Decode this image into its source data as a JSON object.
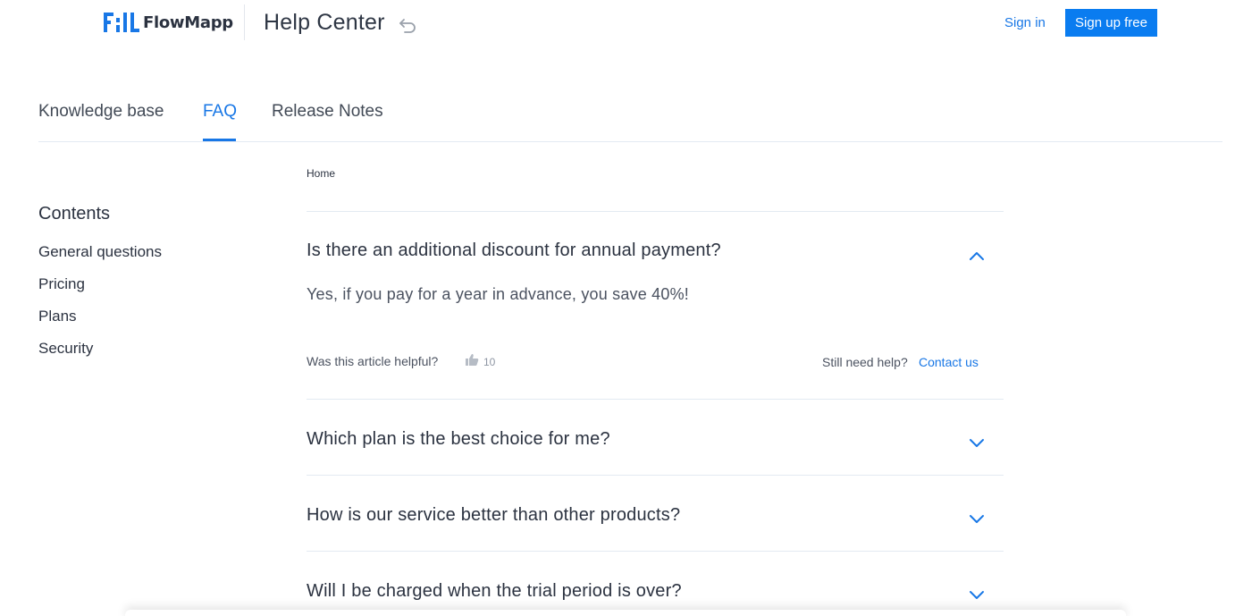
{
  "header": {
    "logo_text": "FlowMapp",
    "help_center": "Help Center",
    "sign_in": "Sign in",
    "sign_up": "Sign up free"
  },
  "tabs": [
    {
      "label": "Knowledge base",
      "active": false
    },
    {
      "label": "FAQ",
      "active": true
    },
    {
      "label": "Release Notes",
      "active": false
    }
  ],
  "sidebar": {
    "title": "Contents",
    "items": [
      "General questions",
      "Pricing",
      "Plans",
      "Security"
    ]
  },
  "breadcrumb": "Home",
  "faq": [
    {
      "question": "Is there an additional discount for annual payment?",
      "expanded": true,
      "answer": "Yes, if you pay for a year in advance, you save 40%!"
    },
    {
      "question": "Which plan is the best choice for me?",
      "expanded": false
    },
    {
      "question": "How is our service better than other products?",
      "expanded": false
    },
    {
      "question": "Will I be charged when the trial period is over?",
      "expanded": false
    }
  ],
  "feedback": {
    "helpful_label": "Was this article helpful?",
    "likes": "10",
    "still_need_help": "Still need help?",
    "contact_us": "Contact us"
  },
  "colors": {
    "accent": "#1877e6",
    "button": "#0a7cf0",
    "text": "#2b3240",
    "divider": "#e3eaf2"
  },
  "icons": [
    "flowmapp-logo-icon",
    "back-arrow-icon",
    "chevron-up-icon",
    "chevron-down-icon",
    "thumbs-up-icon"
  ]
}
